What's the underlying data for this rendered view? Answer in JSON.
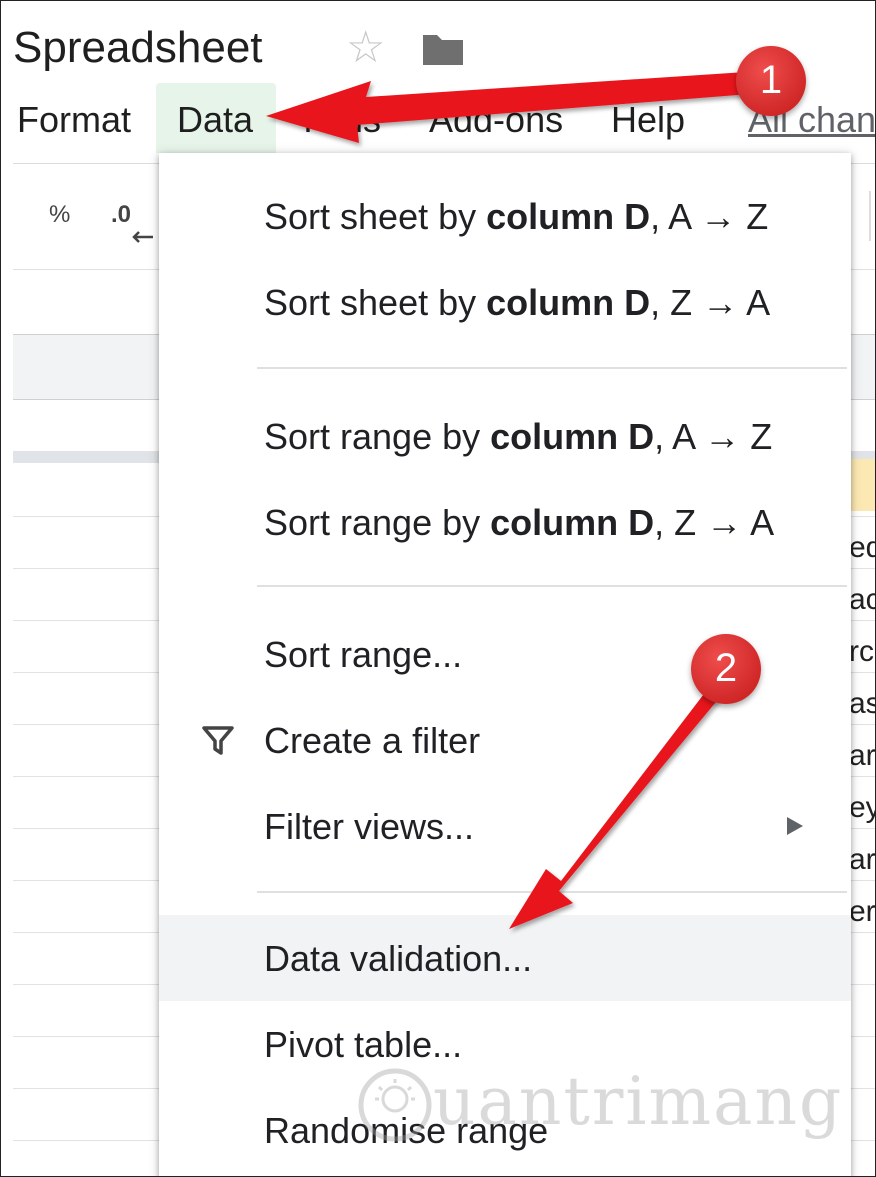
{
  "doc": {
    "title": "Spreadsheet"
  },
  "menubar": {
    "items": [
      "Format",
      "Data",
      "Tools",
      "Add-ons",
      "Help"
    ],
    "all_changes": "All chan"
  },
  "toolbar": {
    "percent": "%",
    "decimal": ".0"
  },
  "sheet": {
    "cell_fragments": [
      "ed",
      "ac",
      "rc",
      "as",
      "ar",
      "ey",
      "ar",
      "er"
    ]
  },
  "data_menu": {
    "sort_sheet_az": {
      "pre": "Sort sheet by ",
      "bold": "column D",
      "post": ", A → Z"
    },
    "sort_sheet_za": {
      "pre": "Sort sheet by ",
      "bold": "column D",
      "post": ", Z → A"
    },
    "sort_range_az": {
      "pre": "Sort range by ",
      "bold": "column D",
      "post": ", A → Z"
    },
    "sort_range_za": {
      "pre": "Sort range by ",
      "bold": "column D",
      "post": ", Z → A"
    },
    "sort_range": "Sort range...",
    "create_filter": "Create a filter",
    "filter_views": "Filter views...",
    "data_validation": "Data validation...",
    "pivot_table": "Pivot table...",
    "randomise_range": "Randomise range"
  },
  "annotations": {
    "badge1": "1",
    "badge2": "2",
    "arrow_color": "#e8171b"
  },
  "watermark": {
    "text": "uantrimang"
  },
  "colors": {
    "menu_active_bg": "#e6f4ea",
    "hover_bg": "#f1f3f4",
    "selected_cell": "#fce8b2"
  }
}
